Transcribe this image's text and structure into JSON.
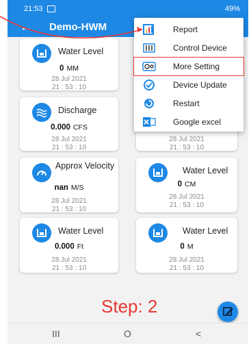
{
  "status": {
    "time": "21:53",
    "right": "49%"
  },
  "app": {
    "title": "Demo-HWM"
  },
  "cards": [
    {
      "label": "Water Level",
      "value": "0",
      "unit": "MM",
      "date": "28 Jul 2021",
      "time": "21 : 53 : 10"
    },
    {
      "label": "Discharge",
      "value": "0.000",
      "unit": "CFS",
      "date": "28 Jul 2021",
      "time": "21 : 53 : 10"
    },
    {
      "label": "Approx Velocity",
      "value": "nan",
      "unit": "M/S",
      "date": "28 Jul 2021",
      "time": "21 : 53 : 10"
    },
    {
      "label": "Water Level",
      "value": "0.000",
      "unit": "Ft",
      "date": "28 Jul 2021",
      "time": "21 : 53 : 10"
    },
    {
      "label": "",
      "value": "",
      "unit": "",
      "date": "28 Jul 2021",
      "time": "21 : 53 : 10"
    },
    {
      "label": "Water Level",
      "value": "0",
      "unit": "CM",
      "date": "28 Jul 2021",
      "time": "21 : 53 : 10"
    },
    {
      "label": "Water Level",
      "value": "0",
      "unit": "M",
      "date": "28 Jul 2021",
      "time": "21 : 53 : 10"
    }
  ],
  "menu": {
    "items": [
      {
        "label": "Report",
        "icon": "report-icon"
      },
      {
        "label": "Control Device",
        "icon": "control-device-icon"
      },
      {
        "label": "More Setting",
        "icon": "more-setting-icon",
        "highlighted": true
      },
      {
        "label": "Device Update",
        "icon": "device-update-icon"
      },
      {
        "label": "Restart",
        "icon": "restart-icon"
      },
      {
        "label": "Google excel",
        "icon": "excel-icon"
      }
    ]
  },
  "step": {
    "text": "Step: 2"
  },
  "nav": {
    "recent": "III",
    "home": "O",
    "back": "<"
  },
  "colors": {
    "primary": "#1e88e5",
    "highlight": "#e53935"
  }
}
